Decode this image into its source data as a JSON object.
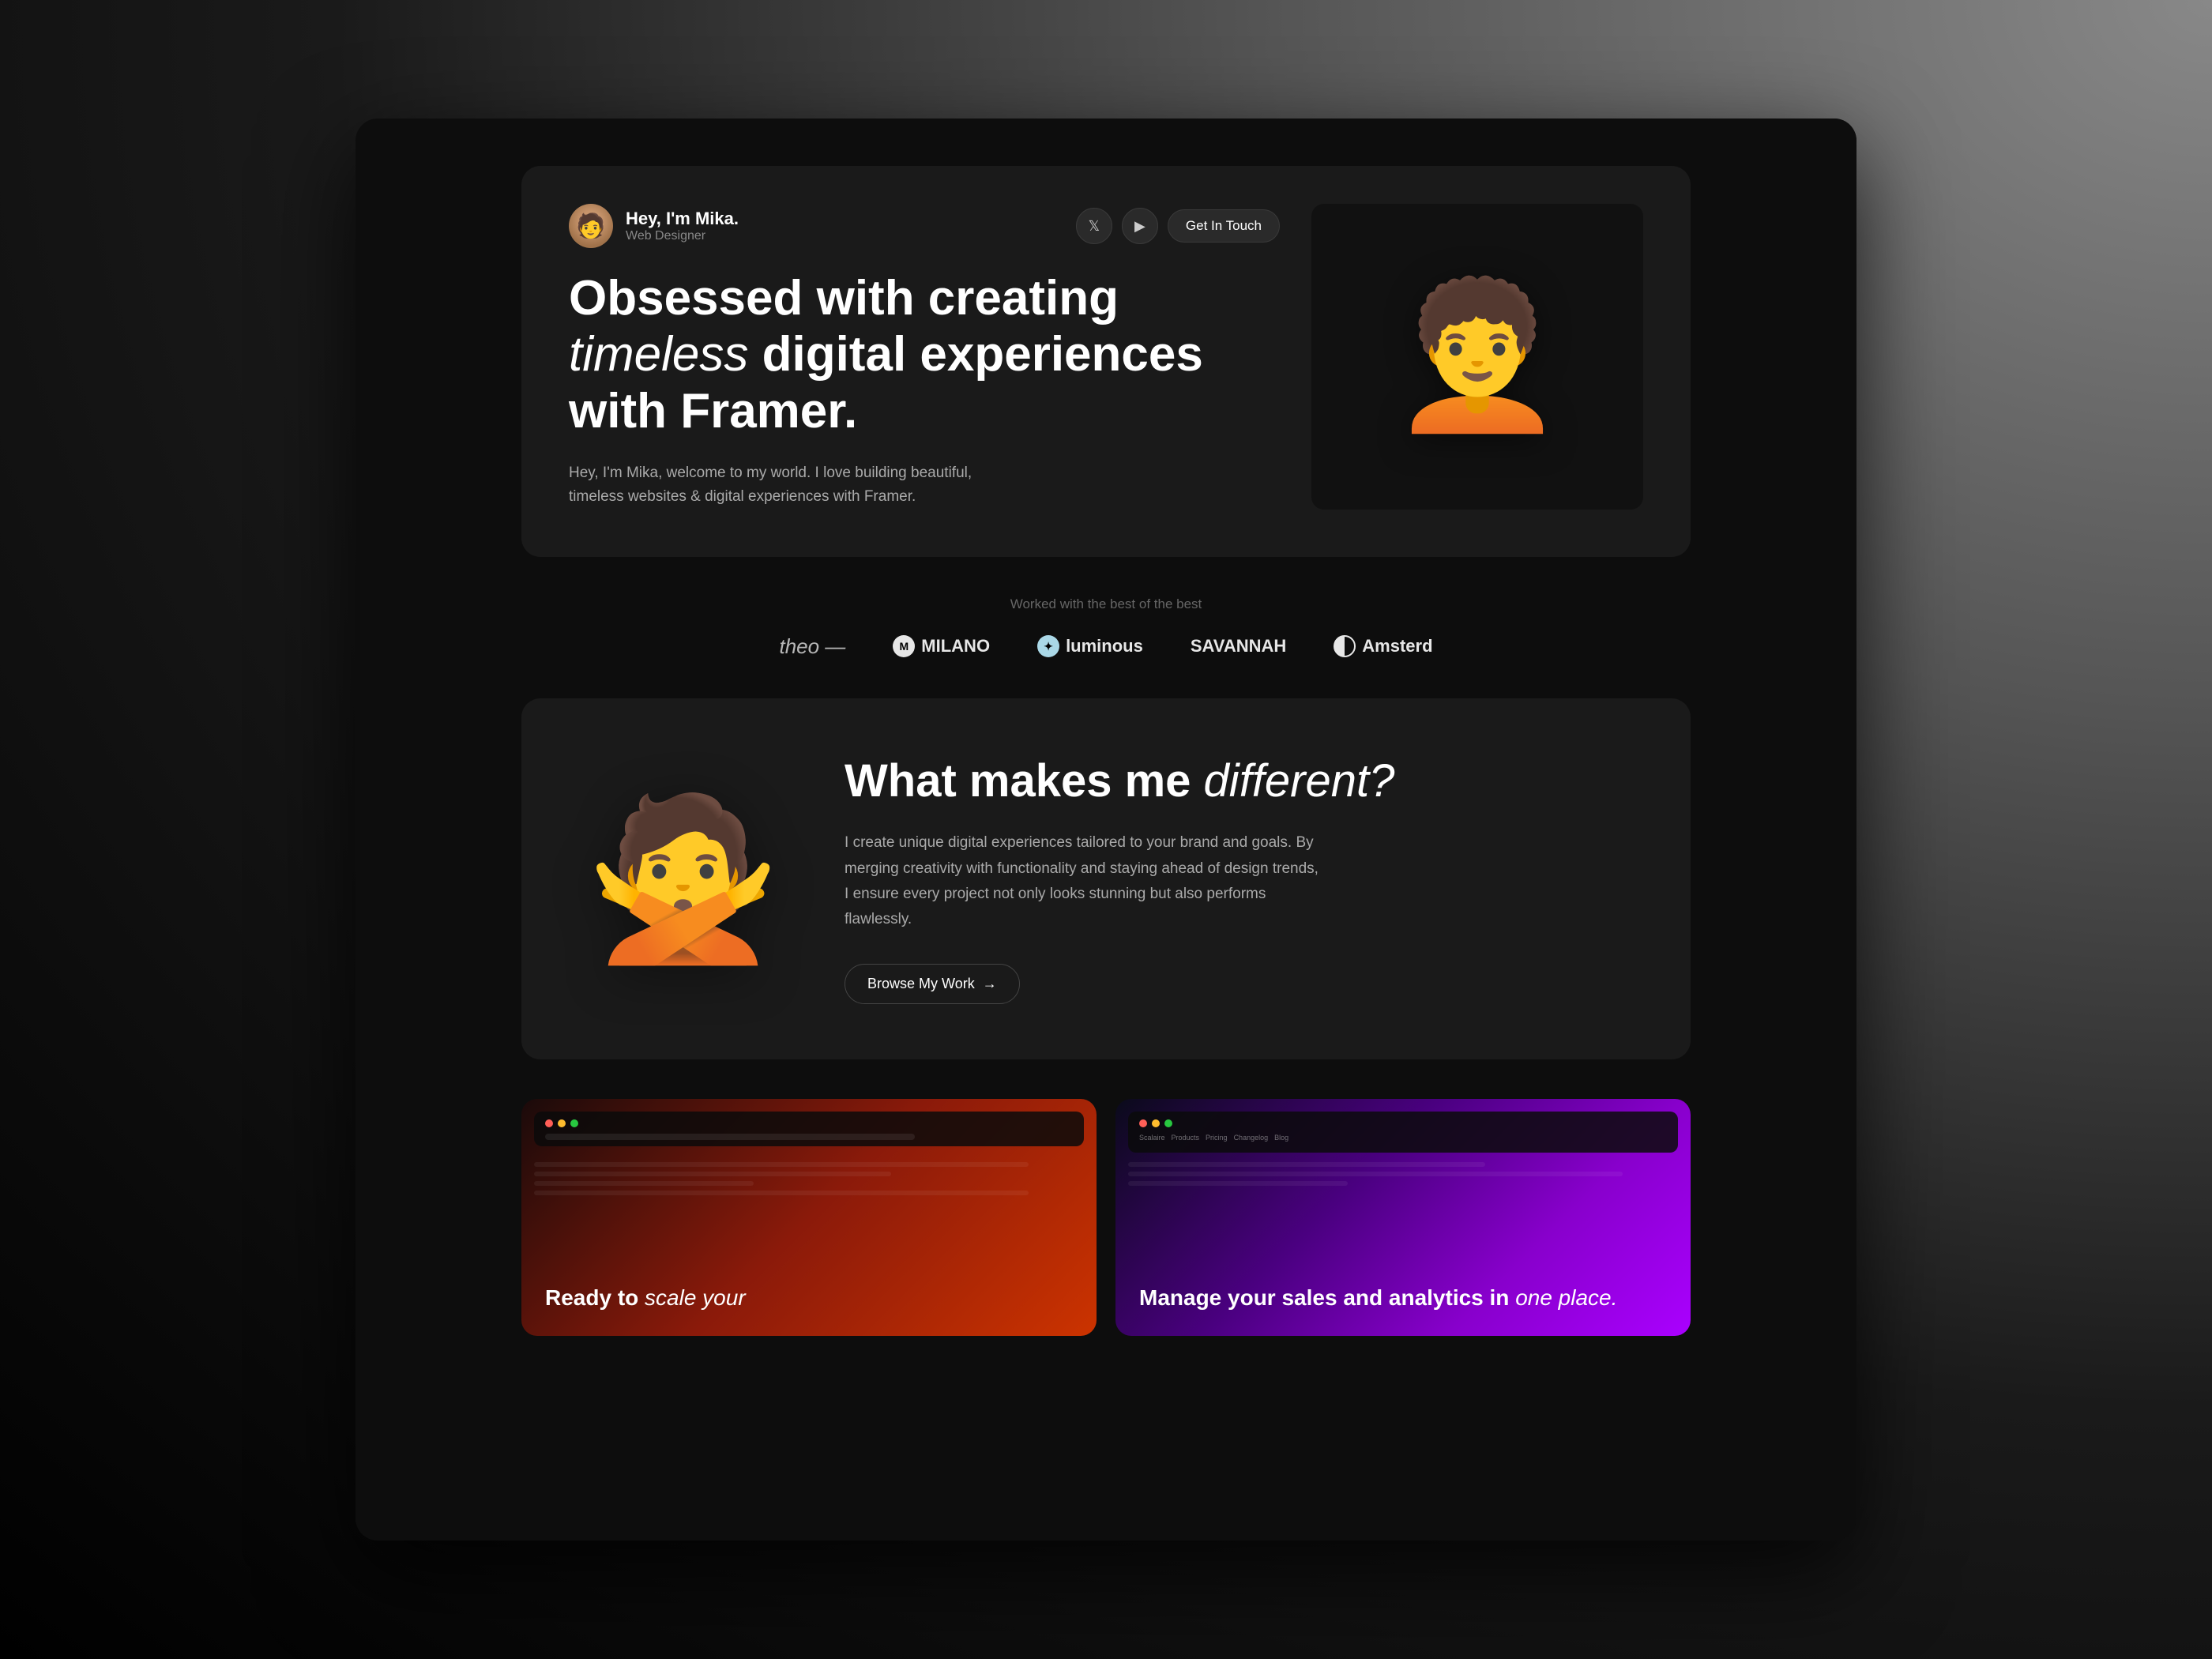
{
  "page": {
    "bg_color": "#0d0d0d"
  },
  "hero": {
    "name": "Hey, I'm Mika.",
    "role": "Web Designer",
    "twitter_label": "𝕏",
    "youtube_label": "▶",
    "contact_label": "Get In Touch",
    "headline_part1": "Obsessed with creating ",
    "headline_italic": "timeless",
    "headline_part2": " digital experiences with Framer.",
    "subtext": "Hey, I'm Mika, welcome to my world. I love building beautiful, timeless websites & digital experiences with Framer."
  },
  "brands": {
    "label": "Worked with the best of the best",
    "items": [
      {
        "name": "Theo",
        "type": "cursive"
      },
      {
        "name": "MILANO",
        "type": "icon-m"
      },
      {
        "name": "luminous",
        "type": "icon-dot"
      },
      {
        "name": "SAVANNAH",
        "type": "text"
      },
      {
        "name": "Amsterd",
        "type": "icon-half"
      }
    ]
  },
  "different": {
    "headline_part1": "What makes me ",
    "headline_italic": "different?",
    "body": "I create unique digital experiences tailored to your brand and goals. By merging creativity with functionality and staying ahead of design trends, I ensure every project not only looks stunning but also performs flawlessly.",
    "button_label": "Browse My Work",
    "button_arrow": "→"
  },
  "portfolio": {
    "card1": {
      "title_part1": "Ready to ",
      "title_italic": "scale your",
      "gradient": "red"
    },
    "card2": {
      "title_part1": "Manage your sales and analytics in ",
      "title_italic": "one place.",
      "gradient": "purple"
    }
  }
}
